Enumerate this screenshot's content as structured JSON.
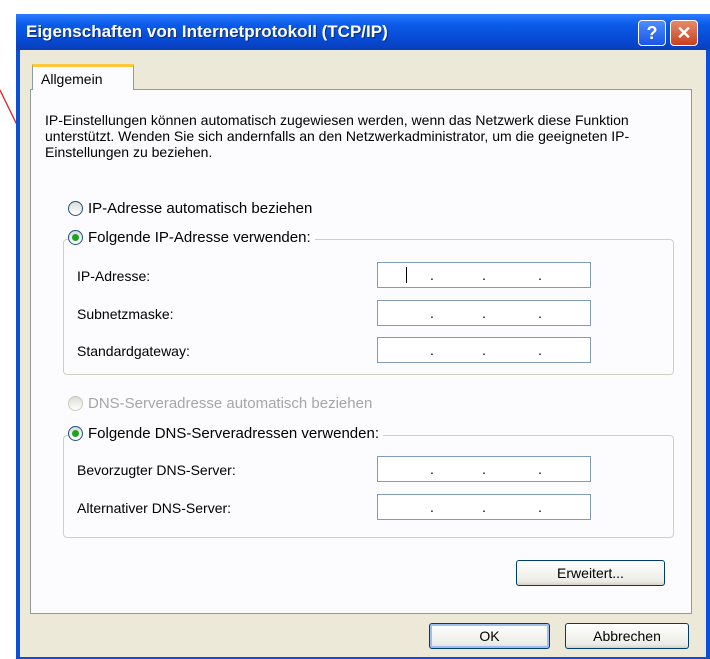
{
  "window": {
    "title": "Eigenschaften von Internetprotokoll (TCP/IP)",
    "help_glyph": "?",
    "close_glyph": "✕"
  },
  "tabs": [
    {
      "label": "Allgemein"
    }
  ],
  "intro_text": "IP-Einstellungen können automatisch zugewiesen werden, wenn das Netzwerk diese Funktion unterstützt. Wenden Sie sich andernfalls an den Netzwerkadministrator, um die geeigneten IP-Einstellungen zu beziehen.",
  "ip_section": {
    "auto_option": "IP-Adresse automatisch beziehen",
    "manual_option": "Folgende IP-Adresse verwenden:",
    "selected": "manual",
    "fields": [
      {
        "label": "IP-Adresse:",
        "value": ""
      },
      {
        "label": "Subnetzmaske:",
        "value": ""
      },
      {
        "label": "Standardgateway:",
        "value": ""
      }
    ]
  },
  "dns_section": {
    "auto_option": "DNS-Serveradresse automatisch beziehen",
    "auto_disabled": true,
    "manual_option": "Folgende DNS-Serveradressen verwenden:",
    "selected": "manual",
    "fields": [
      {
        "label": "Bevorzugter DNS-Server:",
        "value": ""
      },
      {
        "label": "Alternativer DNS-Server:",
        "value": ""
      }
    ]
  },
  "ip_separator": ".",
  "buttons": {
    "advanced": "Erweitert...",
    "ok": "OK",
    "cancel": "Abbrechen"
  },
  "colors": {
    "title_bar": "#0b5be8",
    "dialog_bg": "#ece9d8",
    "annotation_line": "#e02020",
    "radio_selected": "#21a121"
  }
}
